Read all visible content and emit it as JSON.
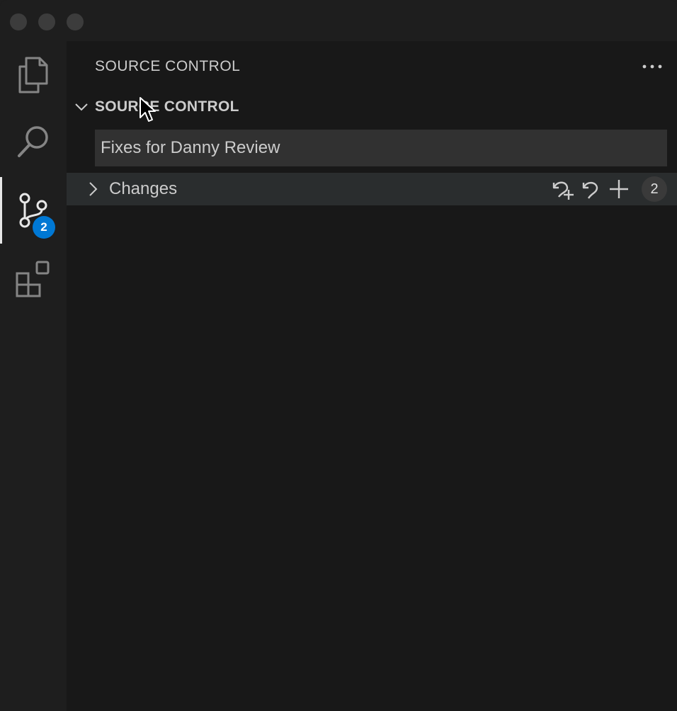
{
  "window": {
    "traffic_lights": [
      "close",
      "minimize",
      "maximize"
    ]
  },
  "activity_bar": {
    "items": [
      {
        "name": "explorer",
        "icon": "files-icon"
      },
      {
        "name": "search",
        "icon": "search-icon"
      },
      {
        "name": "source-control",
        "icon": "source-control-icon",
        "badge": "2",
        "active": true
      },
      {
        "name": "extensions",
        "icon": "extensions-icon"
      }
    ]
  },
  "sidebar": {
    "title": "SOURCE CONTROL",
    "more_icon": "ellipsis-icon",
    "section": {
      "label": "SOURCE CONTROL",
      "chevron": "chevron-down-icon"
    },
    "commit_message": {
      "value": "Fixes for Danny Review"
    },
    "changes": {
      "label": "Changes",
      "chevron": "chevron-right-icon",
      "actions": [
        "discard-all-icon",
        "discard-icon",
        "stage-all-icon"
      ],
      "count": "2"
    }
  },
  "colors": {
    "accent_badge": "#0078d4",
    "background": "#181818",
    "activity_bar": "#1e1e1e",
    "hover_row": "#2a2d2e",
    "input_bg": "#313131",
    "text": "#cccccc"
  }
}
